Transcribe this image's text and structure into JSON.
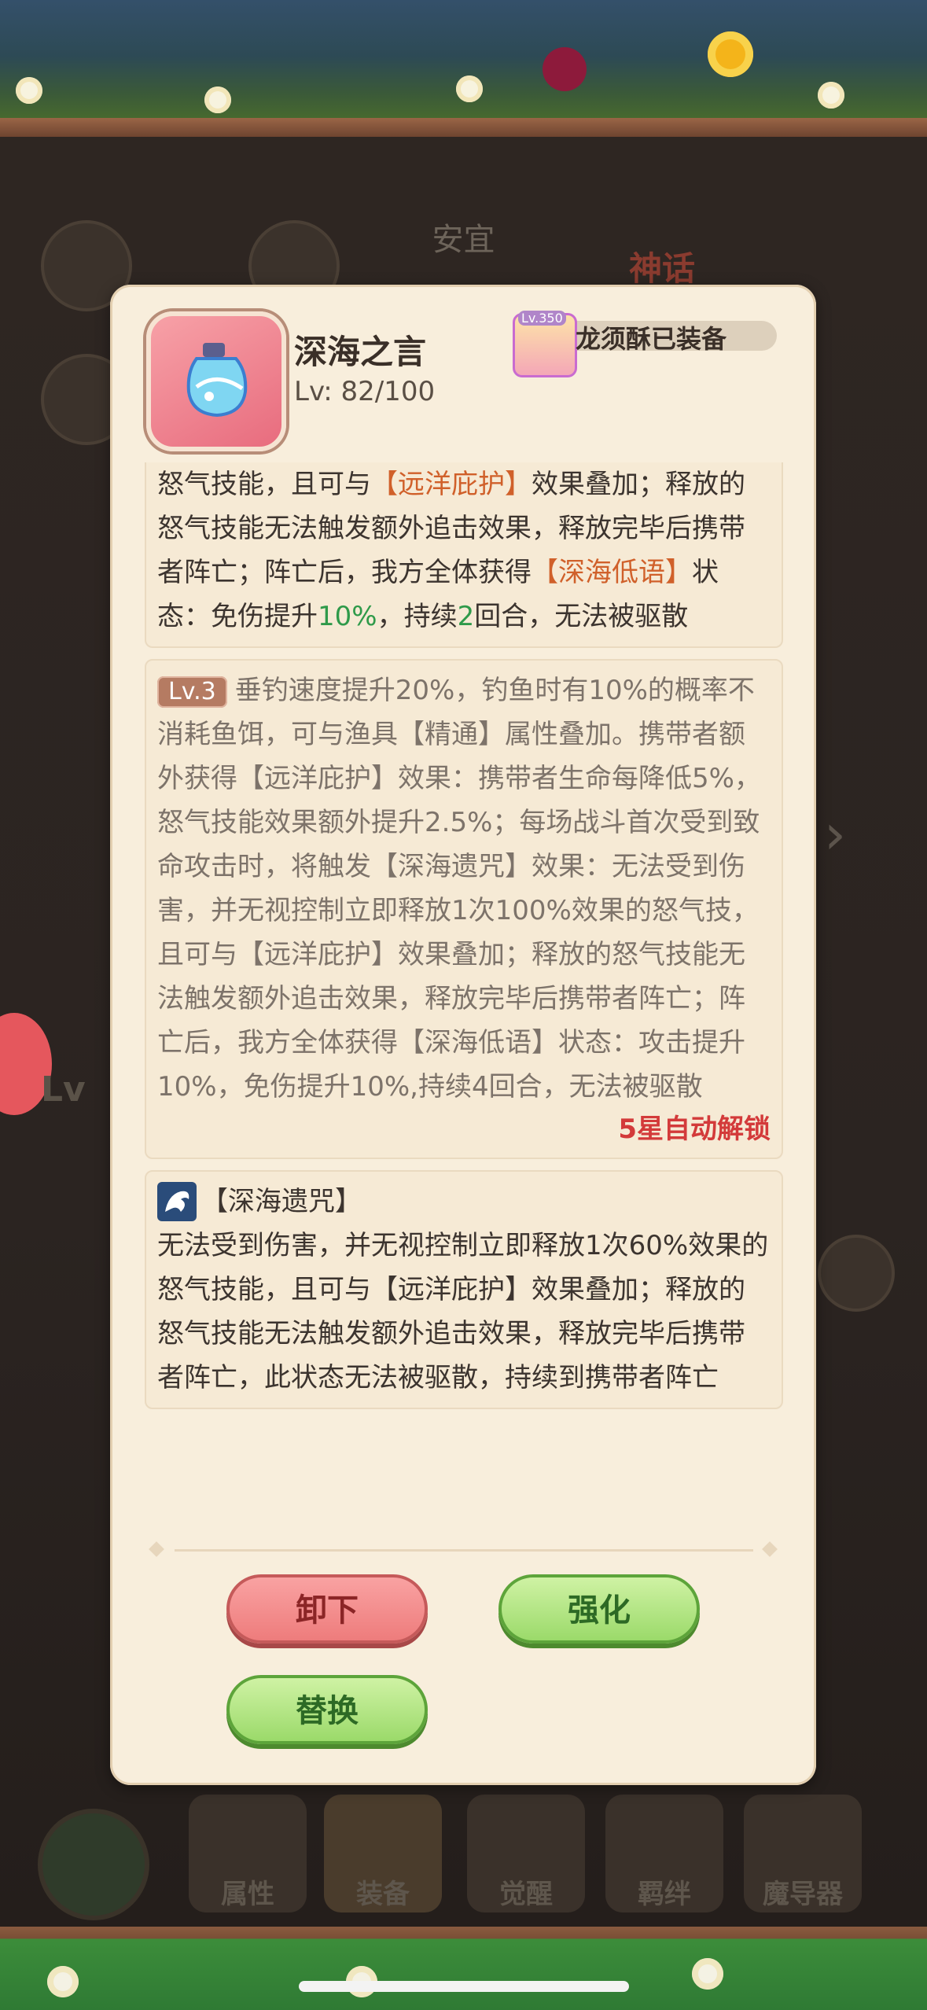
{
  "background": {
    "hero_name": "安宜",
    "myth_tag": "神话",
    "level_label": "Lv",
    "nav_tabs": [
      {
        "label": "属性"
      },
      {
        "label": "装备"
      },
      {
        "label": "觉醒"
      },
      {
        "label": "羁绊"
      },
      {
        "label": "魔导器"
      }
    ]
  },
  "item": {
    "name": "深海之言",
    "level": "Lv: 82/100",
    "equipped_by": "龙须酥已装备",
    "equipped_avatar_badge": "Lv.350"
  },
  "effect_card": {
    "line1_a": "怒气技能，且可与",
    "line1_tag": "【远洋庇护】",
    "line1_b": "效果叠加；释放的怒气技能无法触发额外追击效果，释放完毕后携带者阵亡；阵亡后，我方全体获得",
    "line1_tag2": "【深海低语】",
    "line1_c": "状态：免伤提升",
    "value_pct": "10%",
    "line1_d": "，持续",
    "value_rounds": "2",
    "line1_e": "回合，无法被驱散"
  },
  "lv3_card": {
    "badge": "Lv.3",
    "text": "垂钓速度提升20%，钓鱼时有10%的概率不消耗鱼饵，可与渔具【精通】属性叠加。携带者额外获得【远洋庇护】效果：携带者生命每降低5%，怒气技能效果额外提升2.5%；每场战斗首次受到致命攻击时，将触发【深海遗咒】效果：无法受到伤害，并无视控制立即释放1次100%效果的怒气技，且可与【远洋庇护】效果叠加；释放的怒气技能无法触发额外追击效果，释放完毕后携带者阵亡；阵亡后，我方全体获得【深海低语】状态：攻击提升10%，免伤提升10%,持续4回合，无法被驱散",
    "unlock_note": "5星自动解锁"
  },
  "curse_card": {
    "title": "【深海遗咒】",
    "text": "无法受到伤害，并无视控制立即释放1次60%效果的怒气技能，且可与【远洋庇护】效果叠加；释放的怒气技能无法触发额外追击效果，释放完毕后携带者阵亡，此状态无法被驱散，持续到携带者阵亡"
  },
  "buttons": {
    "unequip": "卸下",
    "enhance": "强化",
    "replace": "替换"
  }
}
